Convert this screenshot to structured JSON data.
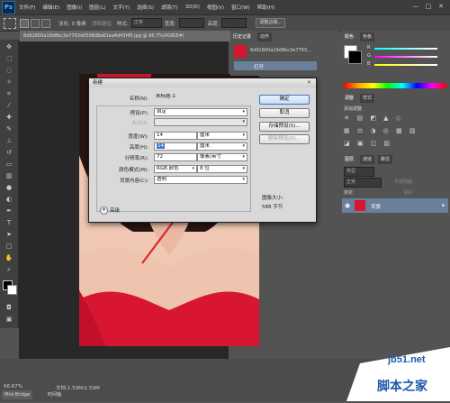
{
  "app": {
    "logo_text": "Ps"
  },
  "menu": [
    "文件(F)",
    "编辑(E)",
    "图像(I)",
    "图层(L)",
    "文字(Y)",
    "选择(S)",
    "滤镜(T)",
    "3D(D)",
    "视图(V)",
    "窗口(W)",
    "帮助(H)"
  ],
  "window_controls": [
    "—",
    "□",
    "✕"
  ],
  "options_bar": {
    "feather_label": "羽化: 0 像素",
    "antialias_label": "消除锯齿",
    "style_label": "样式:",
    "style_value": "正常",
    "width_label": "宽度:",
    "height_label": "高度:",
    "refine_button": "调整边缘..."
  },
  "document": {
    "tab_title": "6d91800a19d8bc3e7763d0508d8a61ea4d43f45.jpg @ 66.7%(RGB/8#)"
  },
  "status": {
    "zoom": "66.67%",
    "doc_info": "文档:1.59M/1.59M",
    "tabs": [
      "Mini Bridge",
      "时间轴"
    ]
  },
  "history_panel": {
    "tabs": [
      "历史记录",
      "动作"
    ],
    "snapshot_name": "6d91800a19d8bc3e7763...",
    "state": "打开"
  },
  "color_panel": {
    "tabs": [
      "颜色",
      "色板"
    ],
    "channels": [
      "R",
      "G",
      "B"
    ]
  },
  "adjustments_panel": {
    "tabs": [
      "调整",
      "样式"
    ],
    "title": "添加调整"
  },
  "layers_panel": {
    "tabs": [
      "图层",
      "通道",
      "路径"
    ],
    "kind_label": "类型",
    "blend_mode": "正常",
    "opacity_label": "不透明度:",
    "lock_label": "锁定:",
    "fill_label": "填充:",
    "layer_name": "背景"
  },
  "new_dialog": {
    "title": "新建",
    "close": "✕",
    "name_label": "名称(N):",
    "name_value": "未标题-1",
    "preset_label": "预设(P):",
    "preset_value": "自定",
    "size_label": "大小(I):",
    "width_label": "宽度(W):",
    "width_value": "14",
    "width_unit": "厘米",
    "height_label": "高度(H):",
    "height_value": "14",
    "height_unit": "厘米",
    "resolution_label": "分辨率(R):",
    "resolution_value": "72",
    "resolution_unit": "像素/英寸",
    "color_mode_label": "颜色模式(M):",
    "color_mode_value": "RGB 颜色",
    "bit_depth_value": "8 位",
    "background_label": "背景内容(C):",
    "background_value": "透明",
    "advanced_label": "高级",
    "ok_button": "确定",
    "cancel_button": "取消",
    "save_preset_button": "存储预设(S)...",
    "delete_preset_button": "删除预设(D)...",
    "image_size_label": "图像大小:",
    "image_size_value": "588 字节"
  },
  "watermark": {
    "site": "jb51.net",
    "name": "脚本之家"
  },
  "colors": {
    "arrow": "#d62a2a",
    "accent_blue": "#3a76c4"
  }
}
